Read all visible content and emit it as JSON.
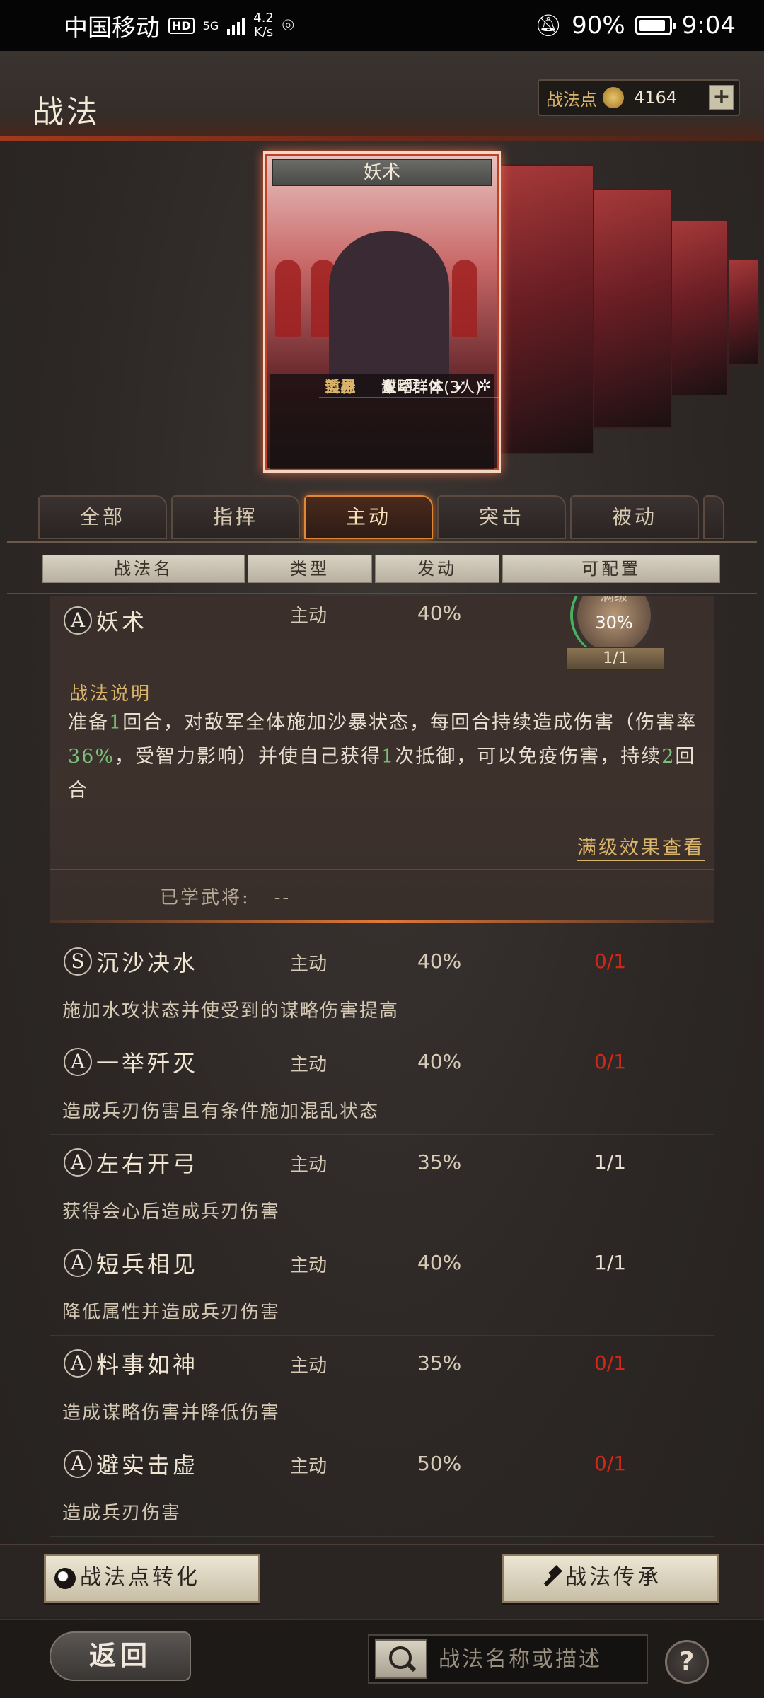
{
  "status_bar": {
    "carrier": "中国移动",
    "hd": "HD",
    "network": "5G",
    "speed_value": "4.2",
    "speed_unit": "K/s",
    "battery": "90%",
    "time": "9:04"
  },
  "header": {
    "title": "战法",
    "points_label": "战法点",
    "points_value": "4164",
    "plus_label": "+"
  },
  "card": {
    "title": "妖术",
    "apply_label": "适用",
    "type_label": "类型",
    "type_value": "主动",
    "effect_label": "效果",
    "effect_value": "谋略群体",
    "target_label": "目标",
    "target_value": "敌军群体(3人)",
    "apply_icons": [
      "cavalry-icon",
      "shield-icon",
      "bow-icon",
      "spear-icon",
      "wheel-icon"
    ]
  },
  "tabs": [
    {
      "label": "全部"
    },
    {
      "label": "指挥"
    },
    {
      "label": "主动"
    },
    {
      "label": "突击"
    },
    {
      "label": "被动"
    }
  ],
  "columns": {
    "name": "战法名",
    "type": "类型",
    "rate": "发动",
    "config": "可配置"
  },
  "expanded": {
    "grade": "A",
    "name": "妖术",
    "type": "主动",
    "rate": "40%",
    "medallion_level": "满级",
    "medallion_pct": "30%",
    "medallion_plate": "1/1",
    "desc_title": "战法说明",
    "desc_1": "准备",
    "desc_2": "1",
    "desc_3": "回合，对敌军全体施加沙暴状态，每回合持续造成伤害（伤害率",
    "desc_4": "36%",
    "desc_5": "，受智力影响）并使自己获得",
    "desc_6": "1",
    "desc_7": "次抵御，可以免疫伤害，持续",
    "desc_8": "2",
    "desc_9": "回合",
    "full_level_link": "满级效果查看",
    "learned_label": "已学武将:",
    "learned_value": "--"
  },
  "items": [
    {
      "grade": "S",
      "name": "沉沙决水",
      "type": "主动",
      "rate": "40%",
      "config": "0/1",
      "brief": "施加水攻状态并使受到的谋略伤害提高"
    },
    {
      "grade": "A",
      "name": "一举歼灭",
      "type": "主动",
      "rate": "40%",
      "config": "0/1",
      "brief": "造成兵刃伤害且有条件施加混乱状态"
    },
    {
      "grade": "A",
      "name": "左右开弓",
      "type": "主动",
      "rate": "35%",
      "config": "1/1",
      "brief": "获得会心后造成兵刃伤害"
    },
    {
      "grade": "A",
      "name": "短兵相见",
      "type": "主动",
      "rate": "40%",
      "config": "1/1",
      "brief": "降低属性并造成兵刃伤害"
    },
    {
      "grade": "A",
      "name": "料事如神",
      "type": "主动",
      "rate": "35%",
      "config": "0/1",
      "brief": "造成谋略伤害并降低伤害"
    },
    {
      "grade": "A",
      "name": "避实击虚",
      "type": "主动",
      "rate": "50%",
      "config": "0/1",
      "brief": "造成兵刃伤害"
    }
  ],
  "actions": {
    "convert": "战法点转化",
    "inherit": "战法传承"
  },
  "footer": {
    "back": "返回",
    "search_placeholder": "战法名称或描述",
    "help": "?"
  },
  "colors": {
    "accent_gold": "#d9b46a",
    "highlight_green": "#7cc07c",
    "config_red": "#d02818",
    "active_tab": "#e08838"
  }
}
